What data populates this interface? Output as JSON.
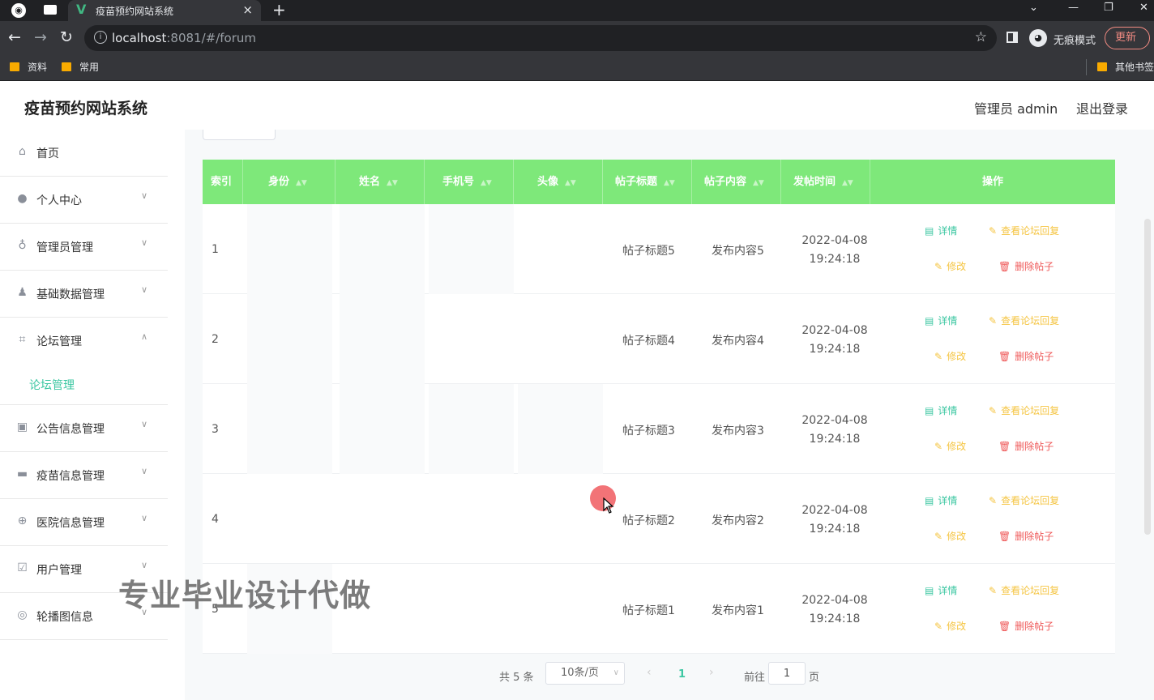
{
  "browser": {
    "tab_title": "疫苗预约网站系统",
    "url_host": "localhost",
    "url_path": ":8081/#/forum",
    "incognito_label": "无痕模式",
    "update_label": "更新",
    "bookmarks": [
      "资料",
      "常用"
    ],
    "other_bookmarks": "其他书签"
  },
  "header": {
    "title": "疫苗预约网站系统",
    "user_label": "管理员 admin",
    "logout_label": "退出登录"
  },
  "sidebar": {
    "items": [
      {
        "label": "首页",
        "icon": "home-icon"
      },
      {
        "label": "个人中心",
        "icon": "person-icon"
      },
      {
        "label": "管理员管理",
        "icon": "microphone-icon"
      },
      {
        "label": "基础数据管理",
        "icon": "user-icon"
      },
      {
        "label": "论坛管理",
        "icon": "crop-icon"
      },
      {
        "label": "公告信息管理",
        "icon": "chart-icon"
      },
      {
        "label": "疫苗信息管理",
        "icon": "monitor-icon"
      },
      {
        "label": "医院信息管理",
        "icon": "globe-icon"
      },
      {
        "label": "用户管理",
        "icon": "checkbox-icon"
      },
      {
        "label": "轮播图信息",
        "icon": "compass-icon"
      }
    ],
    "active_sub": "论坛管理"
  },
  "table": {
    "columns": [
      "索引",
      "身份",
      "姓名",
      "手机号",
      "头像",
      "帖子标题",
      "帖子内容",
      "发帖时间",
      "操作"
    ],
    "rows": [
      {
        "index": "1",
        "title": "帖子标题5",
        "content": "发布内容5",
        "date": "2022-04-08",
        "time": "19:24:18"
      },
      {
        "index": "2",
        "title": "帖子标题4",
        "content": "发布内容4",
        "date": "2022-04-08",
        "time": "19:24:18"
      },
      {
        "index": "3",
        "title": "帖子标题3",
        "content": "发布内容3",
        "date": "2022-04-08",
        "time": "19:24:18"
      },
      {
        "index": "4",
        "title": "帖子标题2",
        "content": "发布内容2",
        "date": "2022-04-08",
        "time": "19:24:18"
      },
      {
        "index": "5",
        "title": "帖子标题1",
        "content": "发布内容1",
        "date": "2022-04-08",
        "time": "19:24:18"
      }
    ],
    "actions": {
      "detail": "详情",
      "replies": "查看论坛回复",
      "edit": "修改",
      "delete": "删除帖子"
    }
  },
  "pagination": {
    "total": "共 5 条",
    "page_size": "10条/页",
    "current": "1",
    "goto_label": "前往",
    "goto_value": "1",
    "page_label": "页"
  },
  "watermark": "专业毕业设计代做",
  "colors": {
    "header_green": "#7ee87a",
    "accent_teal": "#3cc7a2",
    "warning_yellow": "#f5c542",
    "danger_red": "#ef5a5a"
  }
}
